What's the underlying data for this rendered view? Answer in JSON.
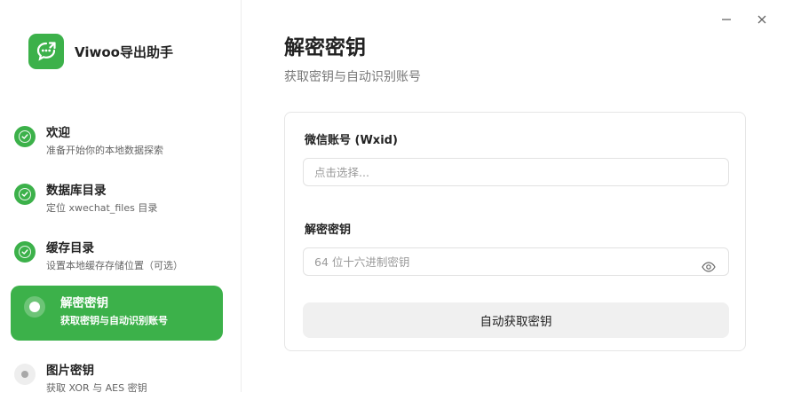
{
  "app": {
    "name": "Viwoo导出助手"
  },
  "window": {
    "minimize_glyph": "—",
    "close_glyph": "✕"
  },
  "steps": [
    {
      "title": "欢迎",
      "subtitle": "准备开始你的本地数据探索",
      "state": "done"
    },
    {
      "title": "数据库目录",
      "subtitle": "定位 xwechat_files 目录",
      "state": "done"
    },
    {
      "title": "缓存目录",
      "subtitle": "设置本地缓存存储位置（可选）",
      "state": "done"
    },
    {
      "title": "解密密钥",
      "subtitle": "获取密钥与自动识别账号",
      "state": "active"
    },
    {
      "title": "图片密钥",
      "subtitle": "获取 XOR 与 AES 密钥",
      "state": "pending"
    }
  ],
  "main": {
    "title": "解密密钥",
    "subtitle": "获取密钥与自动识别账号",
    "wxid": {
      "label": "微信账号 (Wxid)",
      "placeholder": "点击选择...",
      "value": ""
    },
    "key": {
      "label": "解密密钥",
      "placeholder": "64 位十六进制密钥",
      "value": ""
    },
    "auto_button": "自动获取密钥"
  },
  "colors": {
    "accent": "#3cb14a",
    "button_bg": "#f0f0f0"
  },
  "icons": {
    "logo": "chat-export-icon",
    "done": "check-circle-icon",
    "eye": "eye-icon"
  }
}
